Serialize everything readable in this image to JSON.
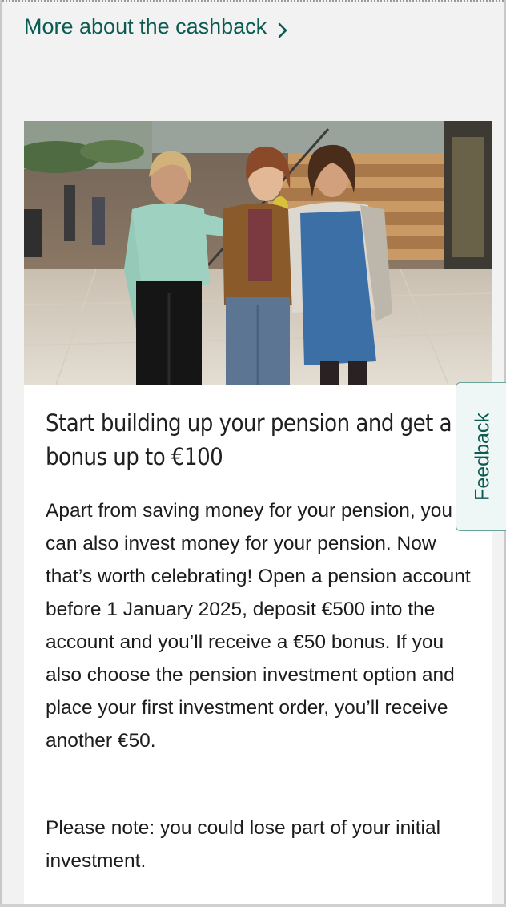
{
  "top_link": {
    "label": "More about the cashback",
    "icon": "chevron-right-icon",
    "color": "#0b5b52"
  },
  "promo_card": {
    "image_alt": "photo of three people being interviewed in a shopping centre",
    "title": "Start building up your pension and get a bonus up to €100",
    "body": "Apart from saving money for your pension, you can also invest money for your pension. Now that’s worth celebrating! Open a pension account before 1 January 2025, deposit €500 into the account and you’ll receive a €50 bonus. If you also choose the pension investment option and place your first investment order, you’ll receive another €50.",
    "note": "Please note: you could lose part of your initial investment."
  },
  "feedback_tab": {
    "label": "Feedback"
  },
  "colors": {
    "accent": "#0b5b52",
    "background": "#f2f2f2",
    "card": "#ffffff"
  }
}
